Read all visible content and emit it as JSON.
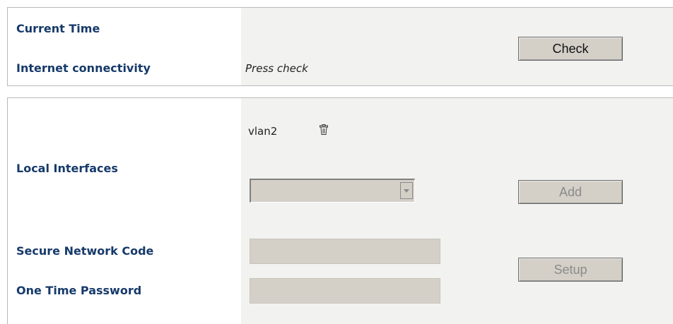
{
  "status": {
    "current_time_label": "Current Time",
    "current_time_value": "",
    "connectivity_label": "Internet connectivity",
    "connectivity_value": "Press check",
    "check_button": "Check"
  },
  "interfaces": {
    "label": "Local Interfaces",
    "items": [
      {
        "name": "vlan2",
        "remove_icon": "trash-icon"
      }
    ],
    "select_value": "",
    "add_button": "Add"
  },
  "setup": {
    "network_code_label": "Secure Network Code",
    "network_code_value": "",
    "otp_label": "One Time Password",
    "otp_value": "",
    "setup_button": "Setup"
  }
}
